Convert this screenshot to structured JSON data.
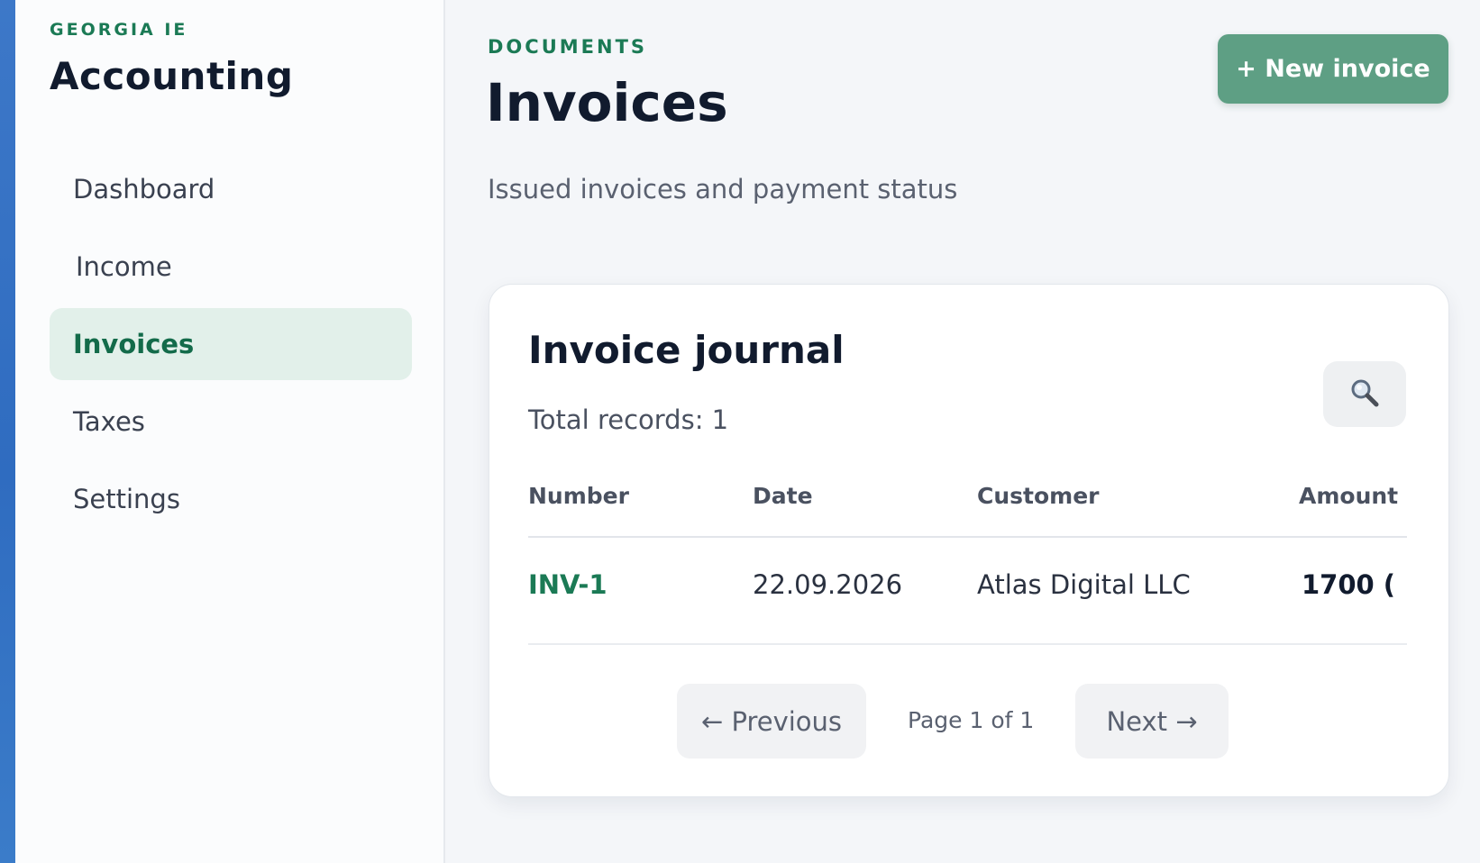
{
  "sidebar": {
    "org": "GEORGIA IE",
    "brand": "Accounting",
    "items": [
      {
        "label": "Dashboard",
        "active": false
      },
      {
        "label": "Income",
        "active": false
      },
      {
        "label": "Invoices",
        "active": true
      },
      {
        "label": "Taxes",
        "active": false
      },
      {
        "label": "Settings",
        "active": false
      }
    ]
  },
  "header": {
    "eyebrow": "DOCUMENTS",
    "title": "Invoices",
    "subtitle": "Issued invoices and payment status",
    "new_button": "+ New invoice"
  },
  "card": {
    "title": "Invoice journal",
    "count": "Total records: 1",
    "search_icon": "search-icon",
    "columns": [
      "Number",
      "Date",
      "Customer",
      "Amount"
    ],
    "rows": [
      {
        "number": "INV-1",
        "date": "22.09.2026",
        "customer": "Atlas Digital LLC",
        "amount": "1700 ("
      }
    ],
    "pagination": {
      "previous": "← Previous",
      "page_info": "Page 1 of 1",
      "next": "Next →"
    }
  },
  "colors": {
    "accent": "#1b7a55",
    "button": "#5e9f84",
    "active_nav_bg": "#e2f0ea",
    "edge": "#2f6cc0"
  }
}
